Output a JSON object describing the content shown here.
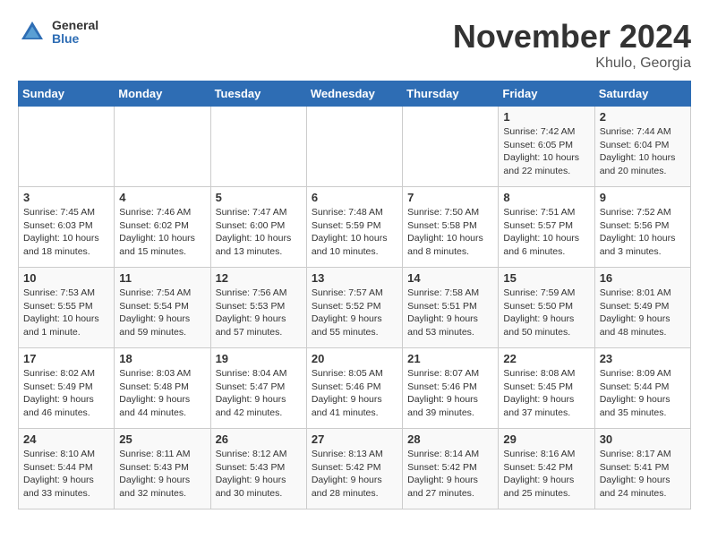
{
  "header": {
    "logo_general": "General",
    "logo_blue": "Blue",
    "title": "November 2024",
    "location": "Khulo, Georgia"
  },
  "days_of_week": [
    "Sunday",
    "Monday",
    "Tuesday",
    "Wednesday",
    "Thursday",
    "Friday",
    "Saturday"
  ],
  "weeks": [
    [
      {
        "day": "",
        "info": ""
      },
      {
        "day": "",
        "info": ""
      },
      {
        "day": "",
        "info": ""
      },
      {
        "day": "",
        "info": ""
      },
      {
        "day": "",
        "info": ""
      },
      {
        "day": "1",
        "info": "Sunrise: 7:42 AM\nSunset: 6:05 PM\nDaylight: 10 hours and 22 minutes."
      },
      {
        "day": "2",
        "info": "Sunrise: 7:44 AM\nSunset: 6:04 PM\nDaylight: 10 hours and 20 minutes."
      }
    ],
    [
      {
        "day": "3",
        "info": "Sunrise: 7:45 AM\nSunset: 6:03 PM\nDaylight: 10 hours and 18 minutes."
      },
      {
        "day": "4",
        "info": "Sunrise: 7:46 AM\nSunset: 6:02 PM\nDaylight: 10 hours and 15 minutes."
      },
      {
        "day": "5",
        "info": "Sunrise: 7:47 AM\nSunset: 6:00 PM\nDaylight: 10 hours and 13 minutes."
      },
      {
        "day": "6",
        "info": "Sunrise: 7:48 AM\nSunset: 5:59 PM\nDaylight: 10 hours and 10 minutes."
      },
      {
        "day": "7",
        "info": "Sunrise: 7:50 AM\nSunset: 5:58 PM\nDaylight: 10 hours and 8 minutes."
      },
      {
        "day": "8",
        "info": "Sunrise: 7:51 AM\nSunset: 5:57 PM\nDaylight: 10 hours and 6 minutes."
      },
      {
        "day": "9",
        "info": "Sunrise: 7:52 AM\nSunset: 5:56 PM\nDaylight: 10 hours and 3 minutes."
      }
    ],
    [
      {
        "day": "10",
        "info": "Sunrise: 7:53 AM\nSunset: 5:55 PM\nDaylight: 10 hours and 1 minute."
      },
      {
        "day": "11",
        "info": "Sunrise: 7:54 AM\nSunset: 5:54 PM\nDaylight: 9 hours and 59 minutes."
      },
      {
        "day": "12",
        "info": "Sunrise: 7:56 AM\nSunset: 5:53 PM\nDaylight: 9 hours and 57 minutes."
      },
      {
        "day": "13",
        "info": "Sunrise: 7:57 AM\nSunset: 5:52 PM\nDaylight: 9 hours and 55 minutes."
      },
      {
        "day": "14",
        "info": "Sunrise: 7:58 AM\nSunset: 5:51 PM\nDaylight: 9 hours and 53 minutes."
      },
      {
        "day": "15",
        "info": "Sunrise: 7:59 AM\nSunset: 5:50 PM\nDaylight: 9 hours and 50 minutes."
      },
      {
        "day": "16",
        "info": "Sunrise: 8:01 AM\nSunset: 5:49 PM\nDaylight: 9 hours and 48 minutes."
      }
    ],
    [
      {
        "day": "17",
        "info": "Sunrise: 8:02 AM\nSunset: 5:49 PM\nDaylight: 9 hours and 46 minutes."
      },
      {
        "day": "18",
        "info": "Sunrise: 8:03 AM\nSunset: 5:48 PM\nDaylight: 9 hours and 44 minutes."
      },
      {
        "day": "19",
        "info": "Sunrise: 8:04 AM\nSunset: 5:47 PM\nDaylight: 9 hours and 42 minutes."
      },
      {
        "day": "20",
        "info": "Sunrise: 8:05 AM\nSunset: 5:46 PM\nDaylight: 9 hours and 41 minutes."
      },
      {
        "day": "21",
        "info": "Sunrise: 8:07 AM\nSunset: 5:46 PM\nDaylight: 9 hours and 39 minutes."
      },
      {
        "day": "22",
        "info": "Sunrise: 8:08 AM\nSunset: 5:45 PM\nDaylight: 9 hours and 37 minutes."
      },
      {
        "day": "23",
        "info": "Sunrise: 8:09 AM\nSunset: 5:44 PM\nDaylight: 9 hours and 35 minutes."
      }
    ],
    [
      {
        "day": "24",
        "info": "Sunrise: 8:10 AM\nSunset: 5:44 PM\nDaylight: 9 hours and 33 minutes."
      },
      {
        "day": "25",
        "info": "Sunrise: 8:11 AM\nSunset: 5:43 PM\nDaylight: 9 hours and 32 minutes."
      },
      {
        "day": "26",
        "info": "Sunrise: 8:12 AM\nSunset: 5:43 PM\nDaylight: 9 hours and 30 minutes."
      },
      {
        "day": "27",
        "info": "Sunrise: 8:13 AM\nSunset: 5:42 PM\nDaylight: 9 hours and 28 minutes."
      },
      {
        "day": "28",
        "info": "Sunrise: 8:14 AM\nSunset: 5:42 PM\nDaylight: 9 hours and 27 minutes."
      },
      {
        "day": "29",
        "info": "Sunrise: 8:16 AM\nSunset: 5:42 PM\nDaylight: 9 hours and 25 minutes."
      },
      {
        "day": "30",
        "info": "Sunrise: 8:17 AM\nSunset: 5:41 PM\nDaylight: 9 hours and 24 minutes."
      }
    ]
  ]
}
